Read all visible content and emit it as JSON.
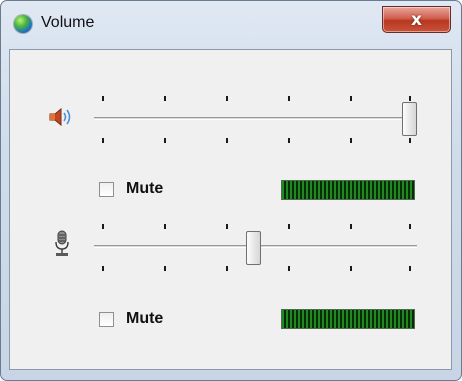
{
  "window": {
    "title": "Volume",
    "close_label": "x"
  },
  "speaker": {
    "icon": "speaker-icon",
    "slider_level": 1.0,
    "mute_label": "Mute",
    "muted": false
  },
  "microphone": {
    "icon": "microphone-icon",
    "slider_level": 0.5,
    "mute_label": "Mute",
    "muted": false
  },
  "colors": {
    "meter_green": "#1f8a1f",
    "close_red": "#c9523b"
  }
}
